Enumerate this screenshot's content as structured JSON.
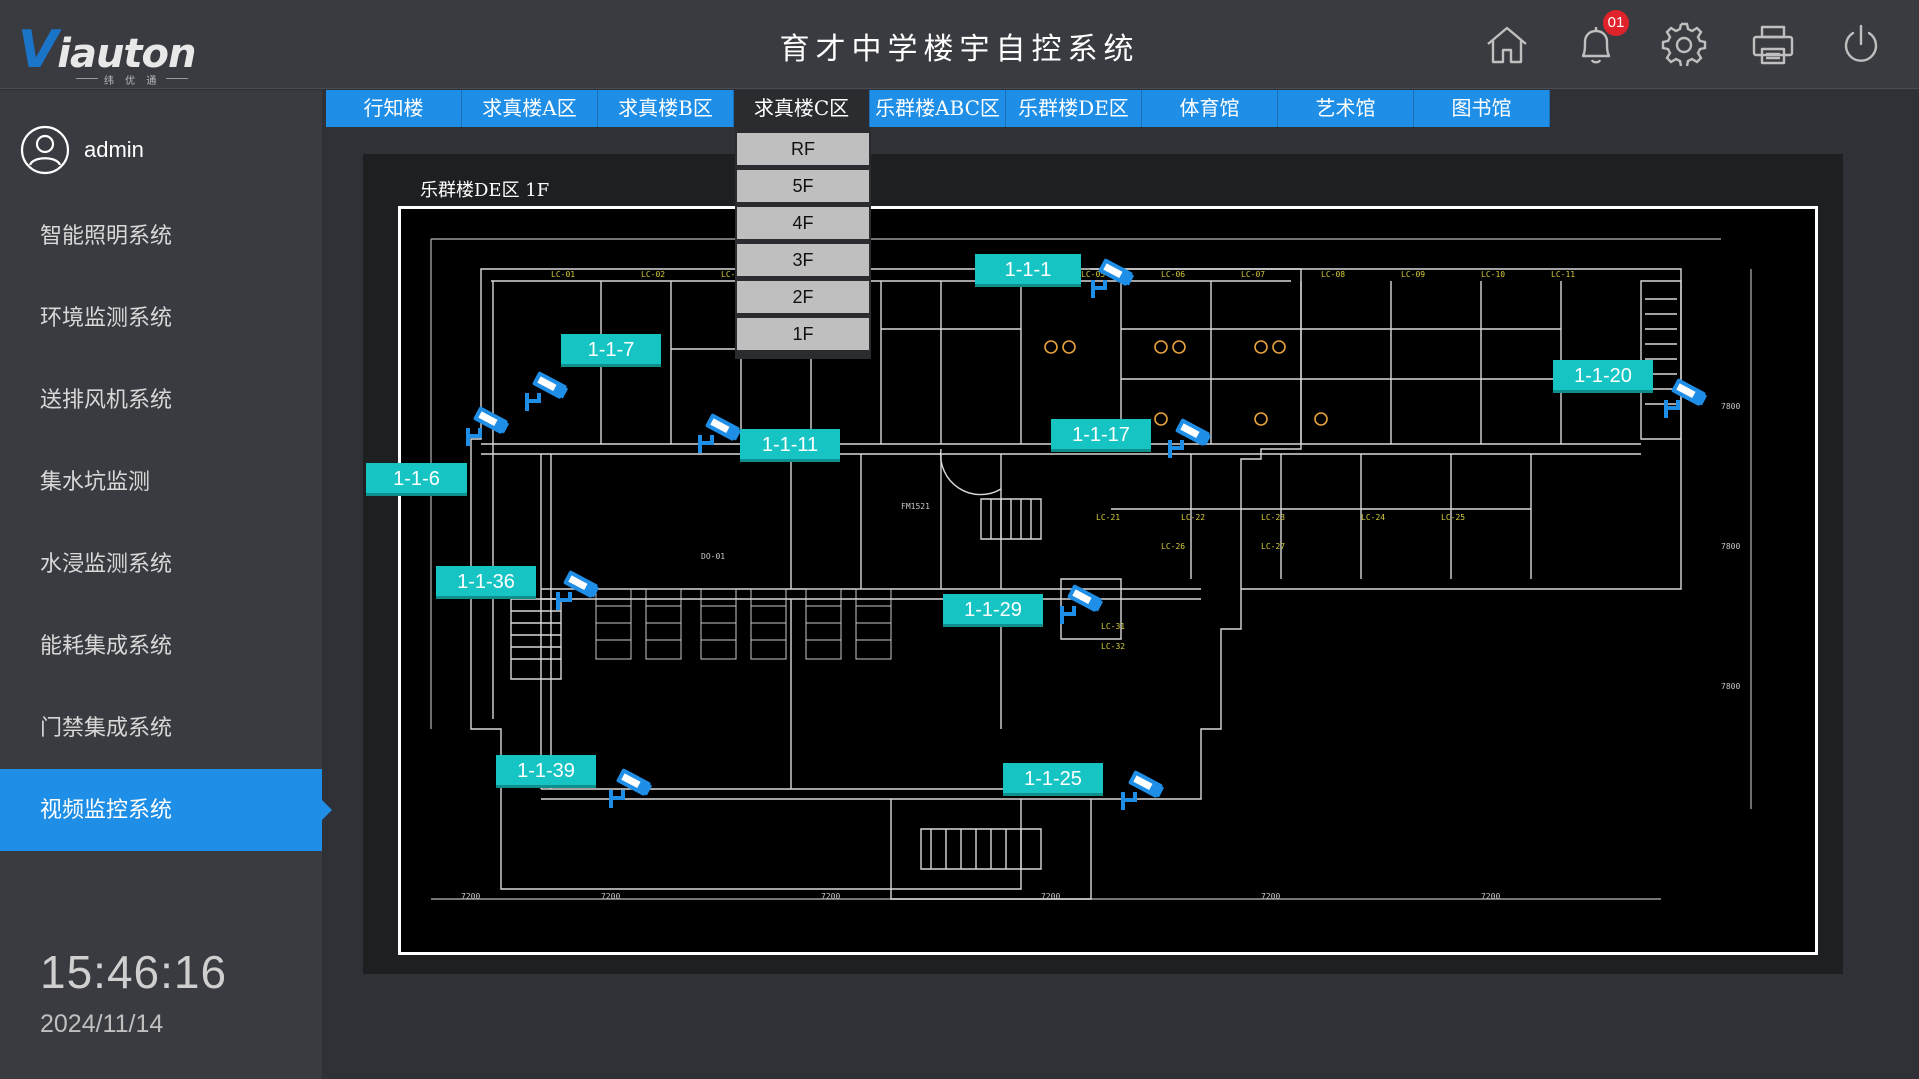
{
  "app": {
    "title": "育才中学楼宇自控系统",
    "logo_main": "iauton",
    "logo_v": "V",
    "logo_sub": "纬 优 通",
    "notifications": "01"
  },
  "user": {
    "name": "admin"
  },
  "menu": [
    {
      "label": "智能照明系统"
    },
    {
      "label": "环境监测系统"
    },
    {
      "label": "送排风机系统"
    },
    {
      "label": "集水坑监测"
    },
    {
      "label": "水浸监测系统"
    },
    {
      "label": "能耗集成系统"
    },
    {
      "label": "门禁集成系统"
    },
    {
      "label": "视频监控系统",
      "active": true
    }
  ],
  "clock": {
    "time": "15:46:16",
    "date": "2024/11/14"
  },
  "buildings": [
    "行知楼",
    "求真楼A区",
    "求真楼B区",
    "求真楼C区",
    "乐群楼ABC区",
    "乐群楼DE区",
    "体育馆",
    "艺术馆",
    "图书馆"
  ],
  "floors": [
    "RF",
    "5F",
    "4F",
    "3F",
    "2F",
    "1F"
  ],
  "floor_plan": {
    "title": "乐群楼DE区 1F"
  },
  "cameras": [
    {
      "id": "1-1-1"
    },
    {
      "id": "1-1-7"
    },
    {
      "id": "1-1-11"
    },
    {
      "id": "1-1-17"
    },
    {
      "id": "1-1-20"
    },
    {
      "id": "1-1-6"
    },
    {
      "id": "1-1-36"
    },
    {
      "id": "1-1-29"
    },
    {
      "id": "1-1-39"
    },
    {
      "id": "1-1-25"
    }
  ],
  "colors": {
    "accent": "#1f8ee6",
    "camera_label": "#17c4c4",
    "camera_icon": "#1f8ee6",
    "alert": "#e0232a"
  },
  "icons": [
    "home-icon",
    "bell-icon",
    "gear-icon",
    "printer-icon",
    "power-icon",
    "user-avatar-icon",
    "camera-icon"
  ]
}
